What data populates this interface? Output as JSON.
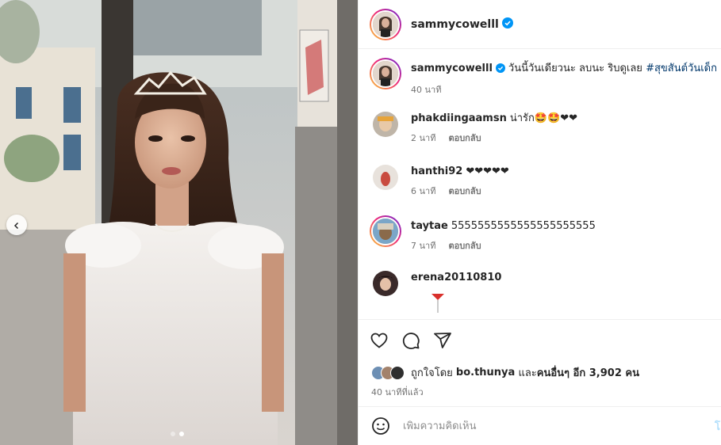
{
  "header": {
    "username": "sammycowelll"
  },
  "caption": {
    "username": "sammycowelll",
    "text": "วันนี้วันเดียวนะ ลบนะ ริบดูเลย",
    "hashtag": "#สุขสันต์วันเด็ก",
    "time": "40 นาที"
  },
  "comments": [
    {
      "username": "phakdiingaamsn",
      "text": "น่ารัก🤩🤩❤❤",
      "time": "2 นาที",
      "reply": "ตอบกลับ"
    },
    {
      "username": "hanthi92",
      "text": "❤❤❤❤❤",
      "time": "6 นาที",
      "reply": "ตอบกลับ"
    },
    {
      "username": "taytae",
      "text": "5555555555555555555555",
      "time": "7 นาที",
      "reply": "ตอบกลับ"
    },
    {
      "username": "erena20110810",
      "text": "",
      "time": "",
      "reply": ""
    }
  ],
  "likes": {
    "prefix": "ถูกใจโดย",
    "user": "bo.thunya",
    "middle": "และ",
    "others": "คนอื่นๆ อีก 3,902 คน"
  },
  "post_time": "40 นาทีที่แล้ว",
  "comment_box": {
    "placeholder": "เพิ่มความคิดเห็น",
    "post_label": "โ"
  },
  "carousel": {
    "current": 2,
    "total": 2
  },
  "colors": {
    "verified": "#0095f6",
    "link": "#00376b",
    "heart": "#ed4956"
  },
  "icons": [
    "chevron-left-icon",
    "verified-badge-icon",
    "heart-icon",
    "comment-icon",
    "share-icon",
    "emoji-icon"
  ]
}
